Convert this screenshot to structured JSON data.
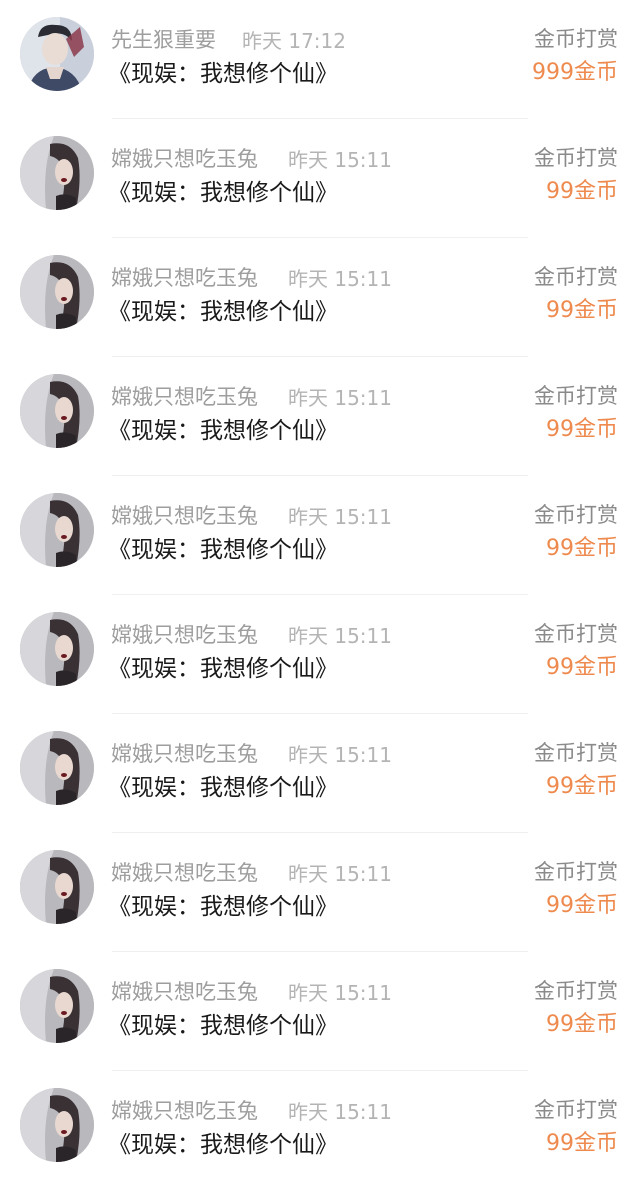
{
  "rows": [
    {
      "avatar_icon": "avatar-portrait-man-icon",
      "user": "先生狠重要",
      "time": "昨天 17:12",
      "book": "《现娱：我想修个仙》",
      "reward_label": "金币打赏",
      "reward_amount": "999金币"
    },
    {
      "avatar_icon": "avatar-portrait-woman-icon",
      "user": "嫦娥只想吃玉兔",
      "time": "昨天 15:11",
      "book": "《现娱：我想修个仙》",
      "reward_label": "金币打赏",
      "reward_amount": "99金币"
    },
    {
      "avatar_icon": "avatar-portrait-woman-icon",
      "user": "嫦娥只想吃玉兔",
      "time": "昨天 15:11",
      "book": "《现娱：我想修个仙》",
      "reward_label": "金币打赏",
      "reward_amount": "99金币"
    },
    {
      "avatar_icon": "avatar-portrait-woman-icon",
      "user": "嫦娥只想吃玉兔",
      "time": "昨天 15:11",
      "book": "《现娱：我想修个仙》",
      "reward_label": "金币打赏",
      "reward_amount": "99金币"
    },
    {
      "avatar_icon": "avatar-portrait-woman-icon",
      "user": "嫦娥只想吃玉兔",
      "time": "昨天 15:11",
      "book": "《现娱：我想修个仙》",
      "reward_label": "金币打赏",
      "reward_amount": "99金币"
    },
    {
      "avatar_icon": "avatar-portrait-woman-icon",
      "user": "嫦娥只想吃玉兔",
      "time": "昨天 15:11",
      "book": "《现娱：我想修个仙》",
      "reward_label": "金币打赏",
      "reward_amount": "99金币"
    },
    {
      "avatar_icon": "avatar-portrait-woman-icon",
      "user": "嫦娥只想吃玉兔",
      "time": "昨天 15:11",
      "book": "《现娱：我想修个仙》",
      "reward_label": "金币打赏",
      "reward_amount": "99金币"
    },
    {
      "avatar_icon": "avatar-portrait-woman-icon",
      "user": "嫦娥只想吃玉兔",
      "time": "昨天 15:11",
      "book": "《现娱：我想修个仙》",
      "reward_label": "金币打赏",
      "reward_amount": "99金币"
    },
    {
      "avatar_icon": "avatar-portrait-woman-icon",
      "user": "嫦娥只想吃玉兔",
      "time": "昨天 15:11",
      "book": "《现娱：我想修个仙》",
      "reward_label": "金币打赏",
      "reward_amount": "99金币"
    },
    {
      "avatar_icon": "avatar-portrait-woman-icon",
      "user": "嫦娥只想吃玉兔",
      "time": "昨天 15:11",
      "book": "《现娱：我想修个仙》",
      "reward_label": "金币打赏",
      "reward_amount": "99金币"
    }
  ],
  "colors": {
    "name": "#9e9e9e",
    "time": "#b4b4b4",
    "book": "#1a1a1a",
    "reward_label": "#8a8a8a",
    "reward_amount": "#ee8a4e",
    "divider": "#efefef"
  }
}
